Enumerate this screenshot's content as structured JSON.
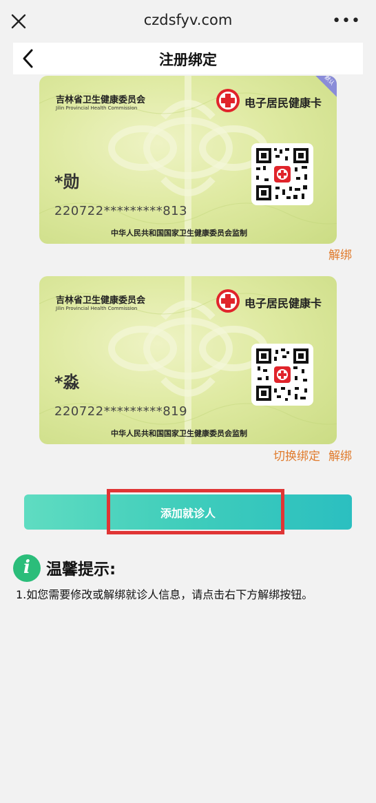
{
  "browser": {
    "url": "czdsfyv.com",
    "close_icon": "close-icon",
    "more_label": "•••"
  },
  "nav": {
    "title": "注册绑定",
    "back_icon": "chevron-left-icon"
  },
  "cards": [
    {
      "issuer": "吉林省卫生健康委员会",
      "issuer_en": "Jilin Provincial Health Commission",
      "brand": "电子居民健康卡",
      "name": "*勋",
      "id_number": "220722*********813",
      "footer": "中华人民共和国国家卫生健康委员会监制",
      "ribbon": "默认",
      "actions": {
        "unbind": "解绑"
      }
    },
    {
      "issuer": "吉林省卫生健康委员会",
      "issuer_en": "Jilin Provincial Health Commission",
      "brand": "电子居民健康卡",
      "name": "*淼",
      "id_number": "220722*********819",
      "footer": "中华人民共和国国家卫生健康委员会监制",
      "actions": {
        "switch": "切换绑定",
        "unbind": "解绑"
      }
    }
  ],
  "add_button": {
    "label": "添加就诊人"
  },
  "tips": {
    "icon_letter": "i",
    "title": "温馨提示:",
    "text": "1.如您需要修改或解绑就诊人信息，请点击右下方解绑按钮。"
  },
  "colors": {
    "accent": "#3fcdbb",
    "link": "#e07b2d",
    "highlight": "#e03535",
    "tip_icon": "#2bbd7a"
  }
}
